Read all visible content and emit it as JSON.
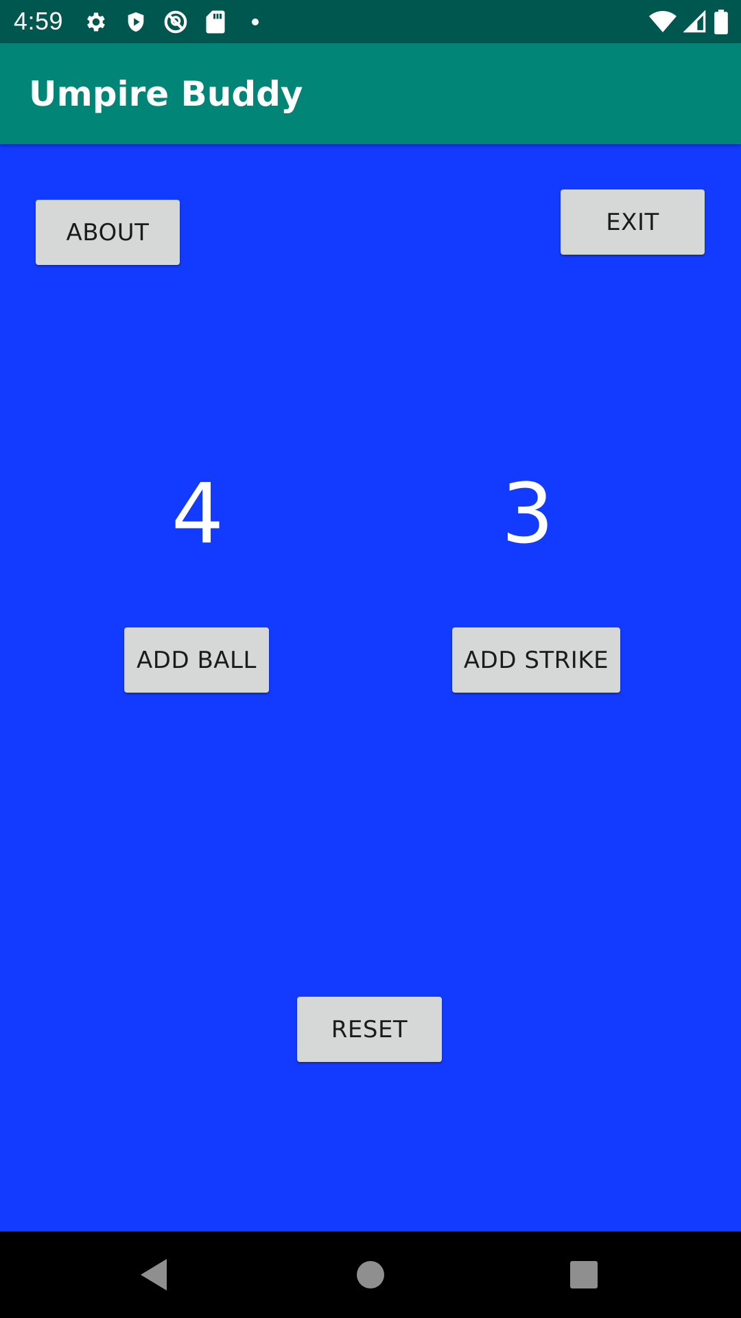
{
  "status_bar": {
    "time": "4:59",
    "left_icons": [
      "gear-icon",
      "shield-play-icon",
      "no-location-icon",
      "sd-card-icon",
      "notification-dot-icon"
    ],
    "right_icons": [
      "wifi-icon",
      "cell-signal-icon",
      "battery-icon"
    ]
  },
  "app_bar": {
    "title": "Umpire Buddy",
    "color": "#008577"
  },
  "main": {
    "background": "#133bff",
    "about_label": "ABOUT",
    "exit_label": "EXIT",
    "ball_count": "4",
    "strike_count": "3",
    "add_ball_label": "ADD BALL",
    "add_strike_label": "ADD STRIKE",
    "reset_label": "RESET"
  },
  "nav_bar": {
    "items": [
      "back-icon",
      "home-icon",
      "recents-icon"
    ]
  }
}
